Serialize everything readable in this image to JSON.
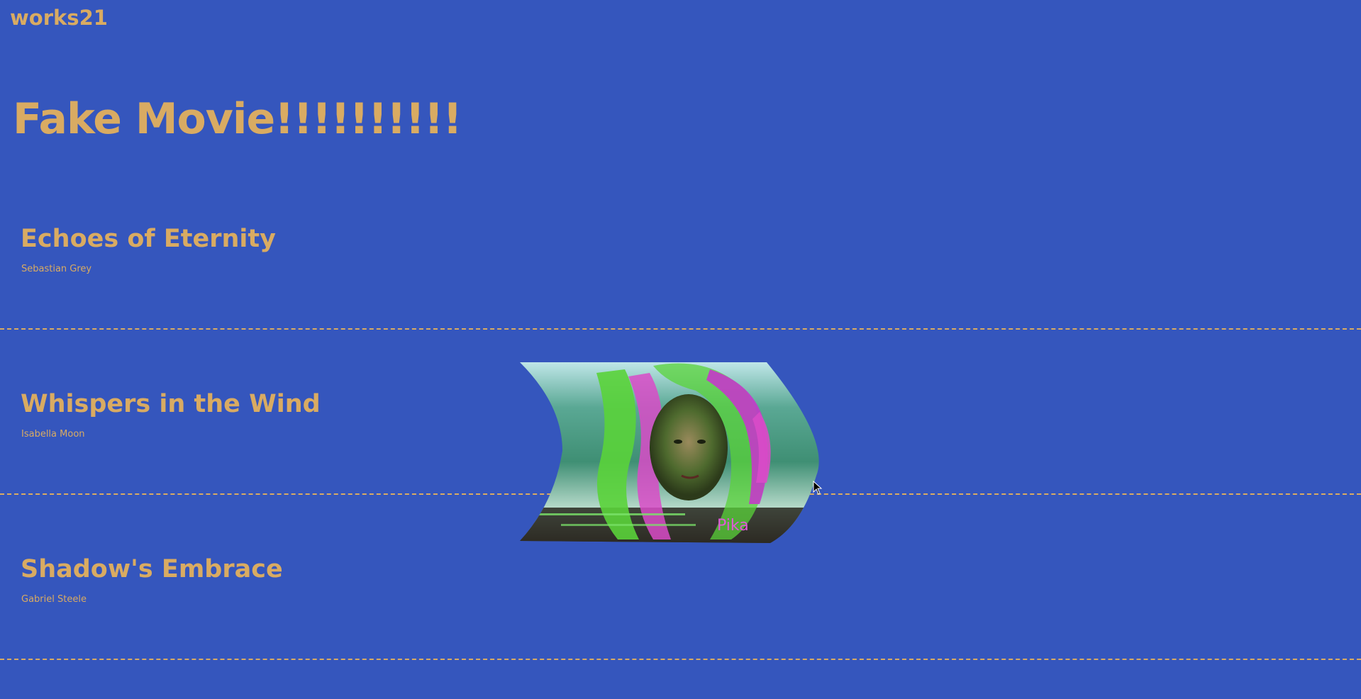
{
  "site": {
    "logo": "works21"
  },
  "page": {
    "title": "Fake Movie!!!!!!!!!!"
  },
  "movies": [
    {
      "title": "Echoes of Eternity",
      "director": "Sebastian Grey"
    },
    {
      "title": "Whispers in the Wind",
      "director": "Isabella Moon"
    },
    {
      "title": "Shadow's Embrace",
      "director": "Gabriel Steele"
    }
  ],
  "preview": {
    "caption": "Pika"
  },
  "colors": {
    "background": "#3556bd",
    "accent": "#d9ab62"
  }
}
